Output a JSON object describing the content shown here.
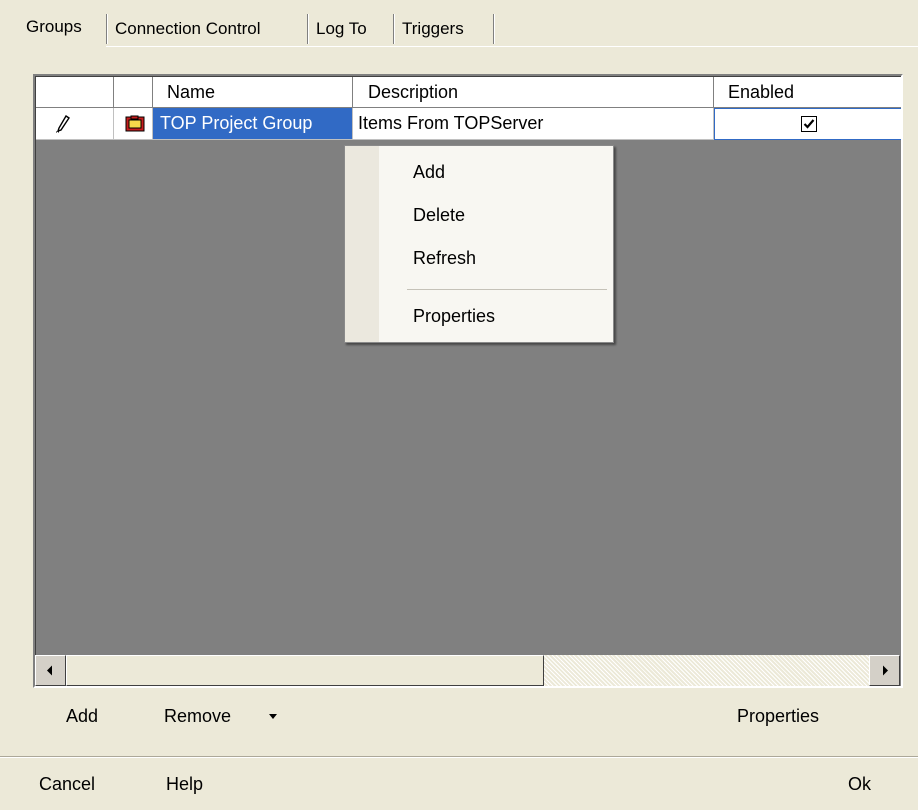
{
  "tabs": [
    {
      "label": "Groups",
      "active": true
    },
    {
      "label": "Connection Control",
      "active": false
    },
    {
      "label": "Log To",
      "active": false
    },
    {
      "label": "Triggers",
      "active": false
    }
  ],
  "grid": {
    "columns": [
      "Name",
      "Description",
      "Enabled"
    ],
    "rows": [
      {
        "row_indicator_icon": "pencil-icon",
        "type_icon": "folder-icon",
        "name": "TOP Project Group",
        "description": "Items From TOPServer",
        "enabled": true
      }
    ]
  },
  "context_menu": {
    "items": [
      "Add",
      "Delete",
      "Refresh",
      "Properties"
    ]
  },
  "toolbar": {
    "add_label": "Add",
    "remove_label": "Remove",
    "remove_dropdown_icon": "triangle-down-icon",
    "properties_label": "Properties"
  },
  "footer": {
    "cancel_label": "Cancel",
    "help_label": "Help",
    "ok_label": "Ok"
  },
  "colors": {
    "window_bg": "#ece9d8",
    "selection": "#316ac5",
    "grid_empty": "#808080"
  }
}
